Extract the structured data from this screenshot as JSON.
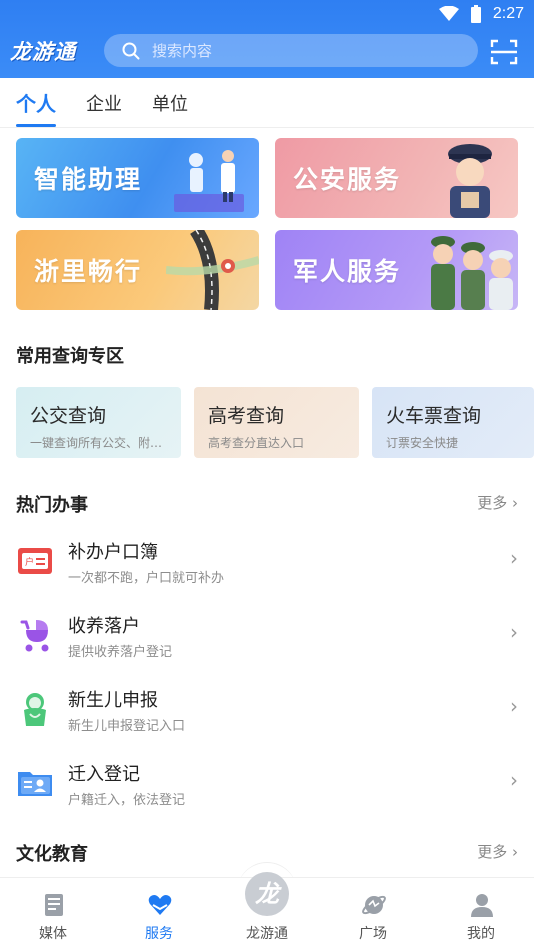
{
  "status": {
    "time": "2:27"
  },
  "header": {
    "logo": "龙游通",
    "search_placeholder": "搜索内容"
  },
  "tabs": [
    {
      "label": "个人",
      "active": true
    },
    {
      "label": "企业",
      "active": false
    },
    {
      "label": "单位",
      "active": false
    }
  ],
  "banners": [
    {
      "label": "智能助理"
    },
    {
      "label": "公安服务"
    },
    {
      "label": "浙里畅行"
    },
    {
      "label": "军人服务"
    }
  ],
  "query_section": {
    "title": "常用查询专区",
    "cards": [
      {
        "title": "公交查询",
        "subtitle": "一键查询所有公交、附…"
      },
      {
        "title": "高考查询",
        "subtitle": "高考查分直达入口"
      },
      {
        "title": "火车票查询",
        "subtitle": "订票安全快捷"
      }
    ]
  },
  "hot_section": {
    "title": "热门办事",
    "more": "更多",
    "items": [
      {
        "title": "补办户口簿",
        "subtitle": "一次都不跑，户口就可补办",
        "icon": "household-register-icon"
      },
      {
        "title": "收养落户",
        "subtitle": "提供收养落户登记",
        "icon": "stroller-icon"
      },
      {
        "title": "新生儿申报",
        "subtitle": "新生儿申报登记入口",
        "icon": "newborn-icon"
      },
      {
        "title": "迁入登记",
        "subtitle": "户籍迁入，依法登记",
        "icon": "id-card-icon"
      }
    ]
  },
  "culture_section": {
    "title": "文化教育",
    "more": "更多"
  },
  "bottom_nav": [
    {
      "label": "媒体",
      "active": false
    },
    {
      "label": "服务",
      "active": true
    },
    {
      "label": "龙游通",
      "active": false
    },
    {
      "label": "广场",
      "active": false
    },
    {
      "label": "我的",
      "active": false
    }
  ],
  "center_logo_glyph": "龙",
  "colors": {
    "primary": "#1f7af2",
    "header": "#2f7ff2"
  }
}
